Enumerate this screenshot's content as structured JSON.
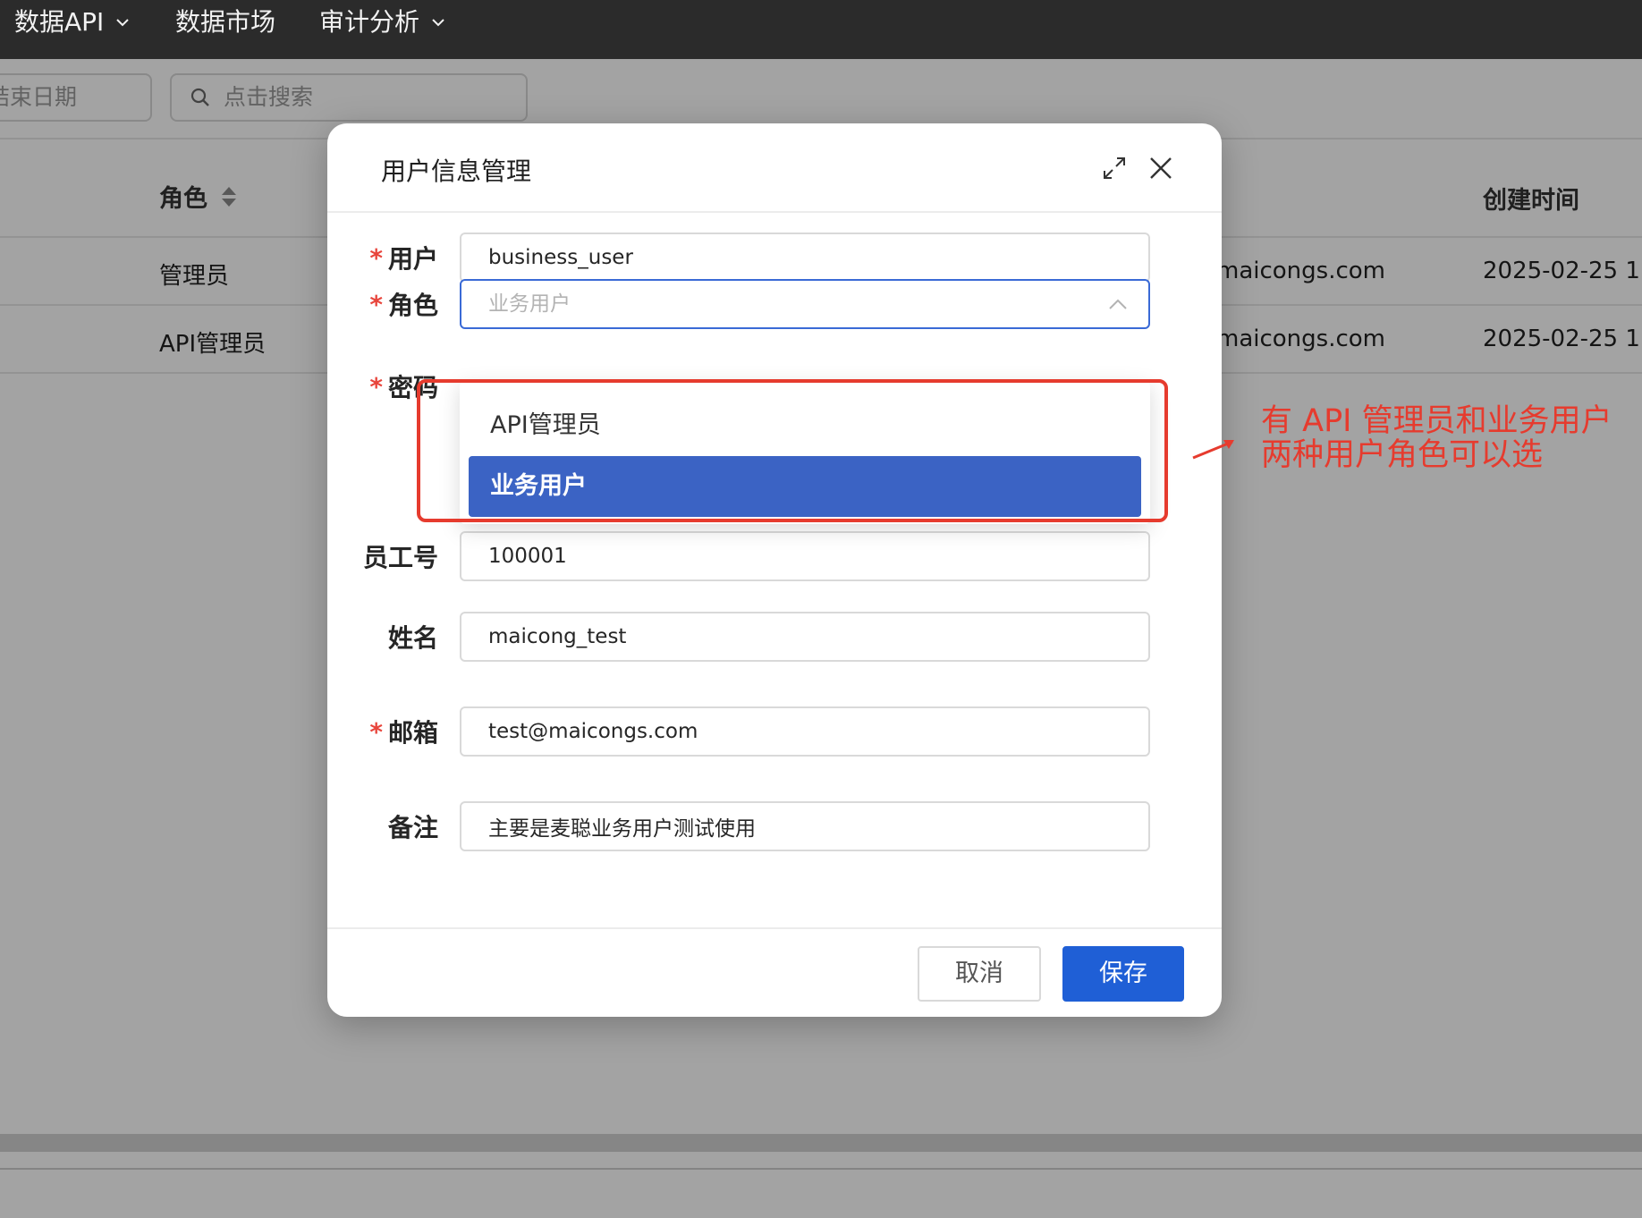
{
  "nav": {
    "items": [
      {
        "label": "数据API",
        "has_caret": true
      },
      {
        "label": "数据市场",
        "has_caret": false
      },
      {
        "label": "审计分析",
        "has_caret": true
      }
    ]
  },
  "toolbar": {
    "end_date_placeholder": "结束日期",
    "search_placeholder": "点击搜索"
  },
  "table": {
    "headers": {
      "role": "角色",
      "created": "创建时间"
    },
    "rows": [
      {
        "role": "管理员",
        "email": "maicongs.com",
        "created": "2025-02-25 1"
      },
      {
        "role": "API管理员",
        "email": "maicongs.com",
        "created": "2025-02-25 1"
      }
    ]
  },
  "modal": {
    "title": "用户信息管理",
    "icons": {
      "expand": "expand-icon",
      "close": "close-icon"
    },
    "fields": {
      "user": {
        "label": "用户",
        "value": "business_user",
        "required": true
      },
      "role": {
        "label": "角色",
        "value": "业务用户",
        "required": true
      },
      "password": {
        "label": "密码",
        "required": true
      },
      "employee_no": {
        "label": "员工号",
        "value": "100001",
        "required": false
      },
      "name": {
        "label": "姓名",
        "value": "maicong_test",
        "required": false
      },
      "email": {
        "label": "邮箱",
        "value": "test@maicongs.com",
        "required": true
      },
      "remark": {
        "label": "备注",
        "value": "主要是麦聪业务用户测试使用",
        "required": false
      }
    },
    "required_mark": "*",
    "role_options": [
      "API管理员",
      "业务用户"
    ],
    "role_selected": "业务用户",
    "buttons": {
      "cancel": "取消",
      "save": "保存"
    }
  },
  "annotation": {
    "line1": "有 API 管理员和业务用户",
    "line2": "两种用户角色可以选",
    "color": "#e63b2e"
  },
  "colors": {
    "topnav": "#2b2b2b",
    "primary": "#1f5fd6",
    "selected_option": "#3b63c4",
    "required": "#e8453c"
  }
}
